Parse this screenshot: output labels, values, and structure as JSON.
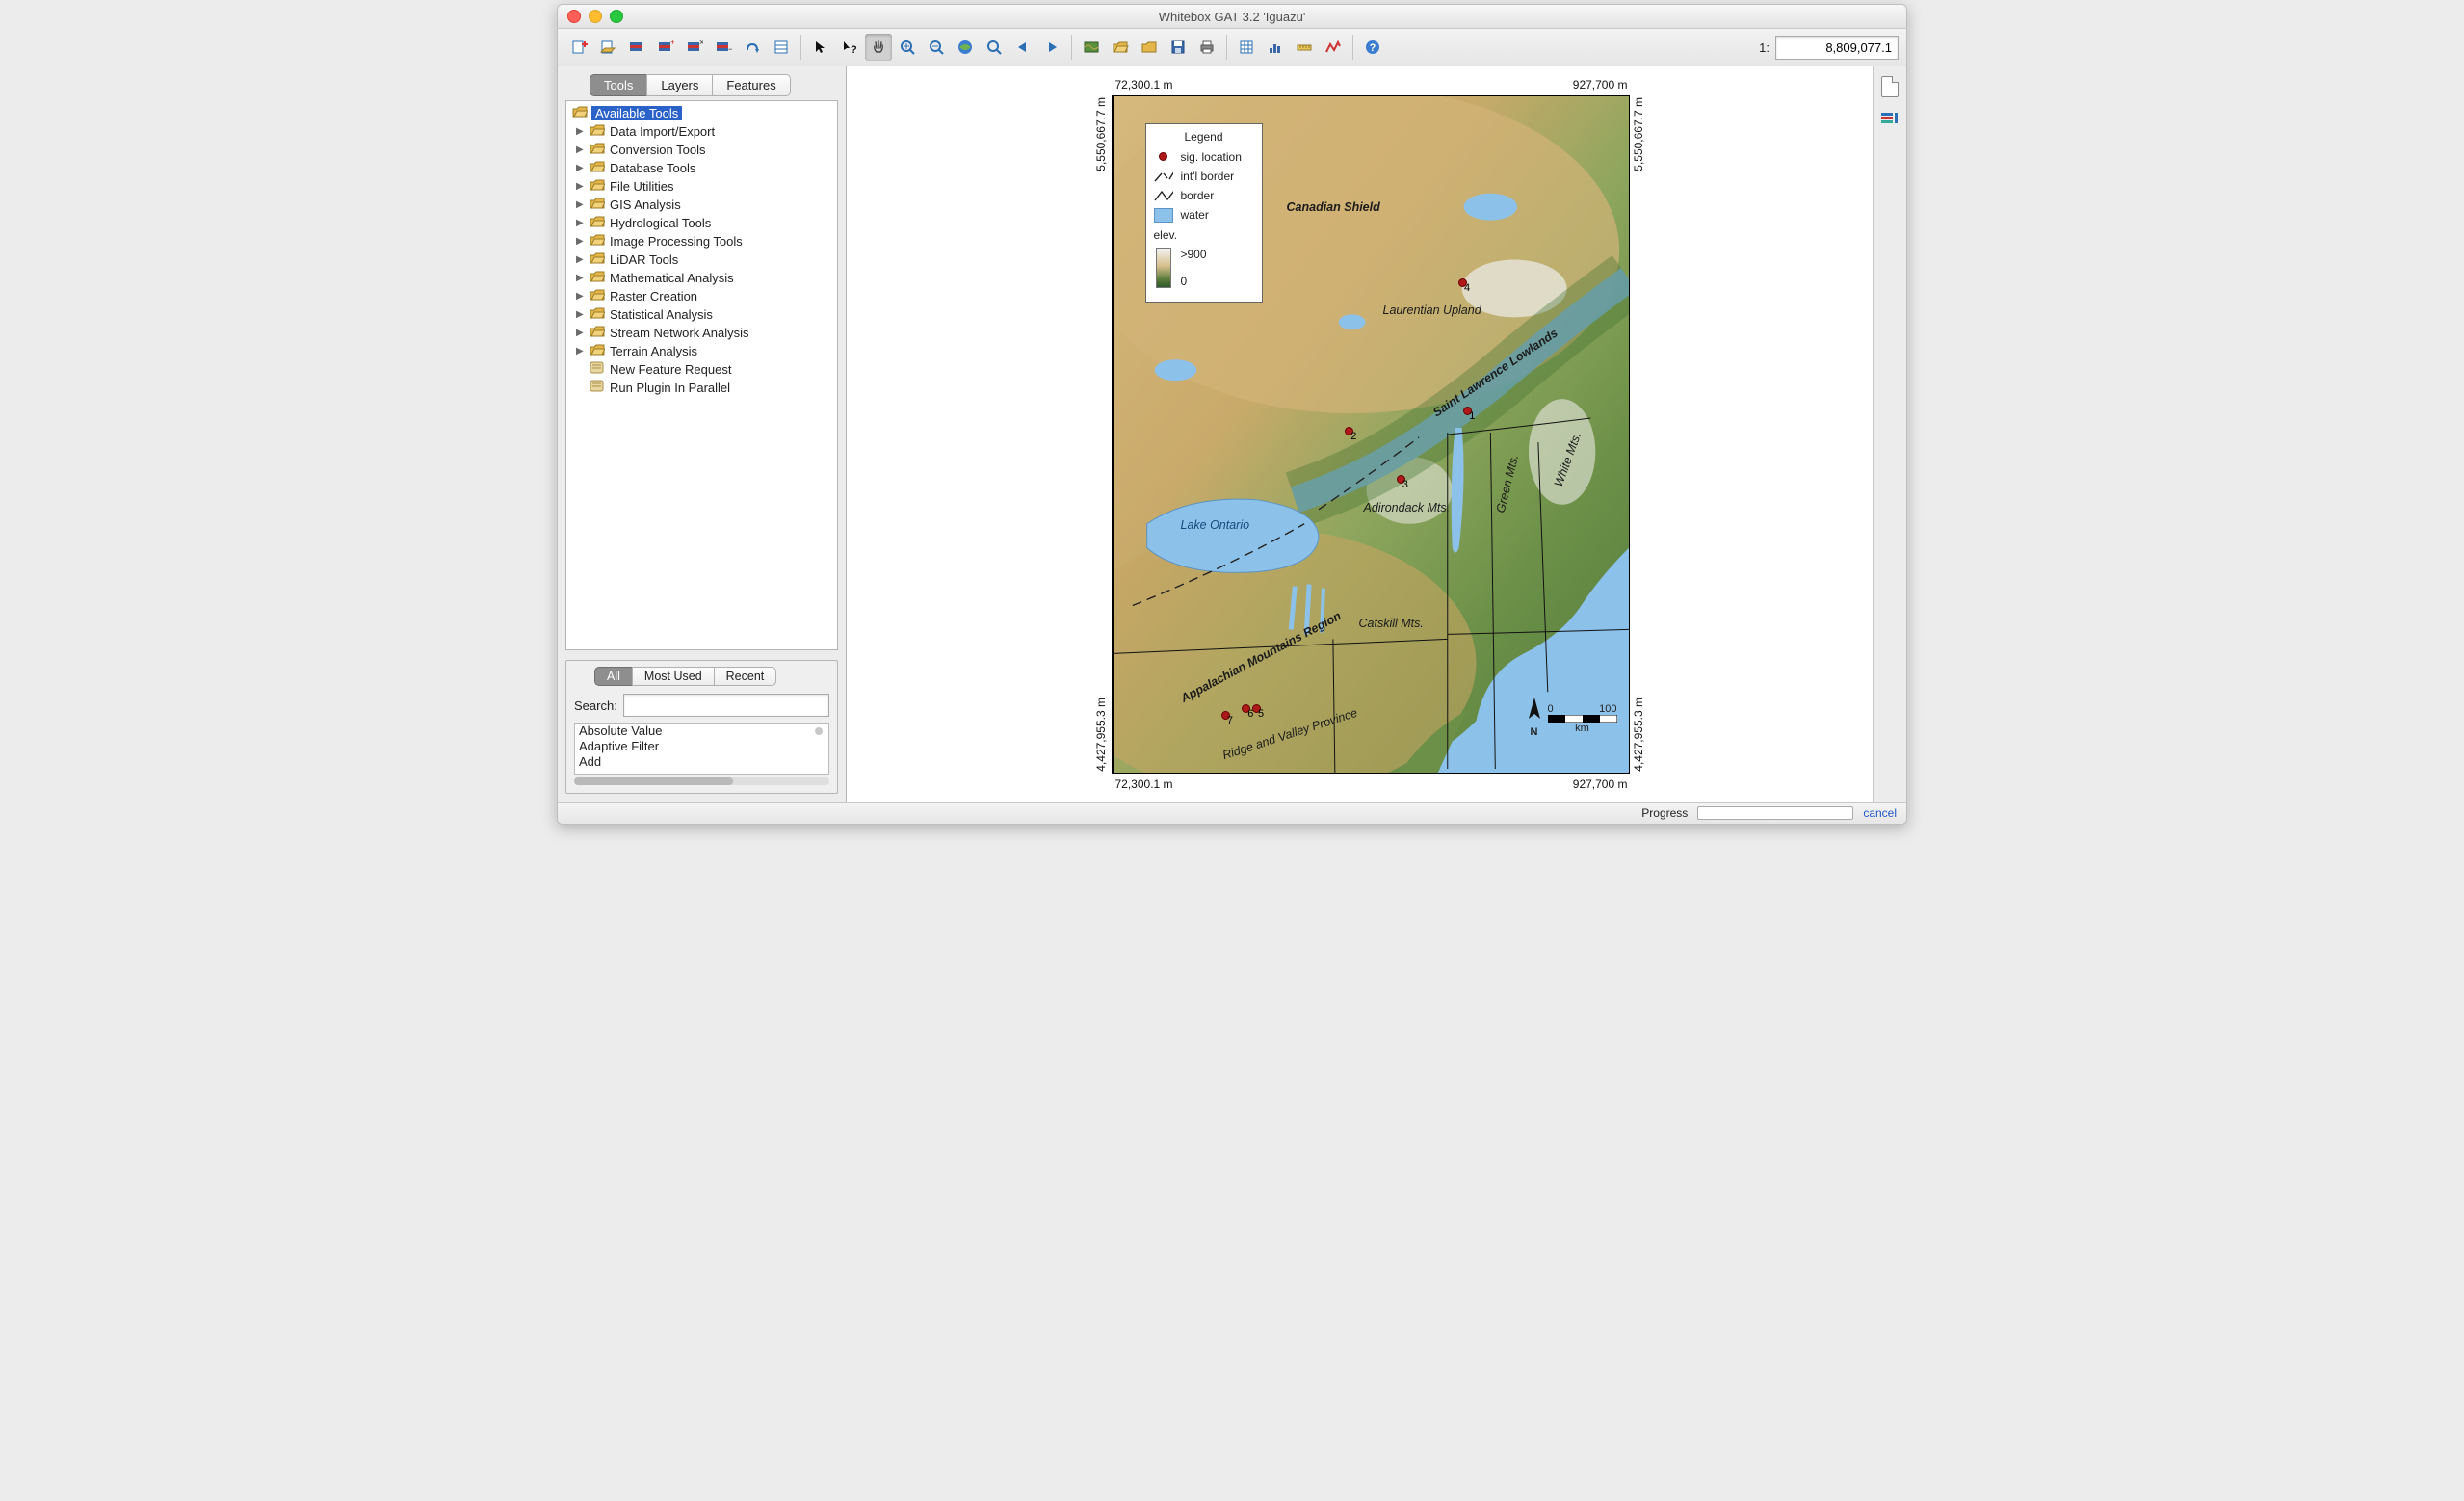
{
  "window": {
    "title": "Whitebox GAT 3.2 'Iguazu'"
  },
  "scale": {
    "prefix": "1:",
    "value": "8,809,077.1"
  },
  "panelTabs": {
    "tools": "Tools",
    "layers": "Layers",
    "features": "Features",
    "active": "tools"
  },
  "tree": {
    "root": "Available Tools",
    "folders": [
      "Data Import/Export",
      "Conversion Tools",
      "Database Tools",
      "File Utilities",
      "GIS Analysis",
      "Hydrological Tools",
      "Image Processing Tools",
      "LiDAR Tools",
      "Mathematical Analysis",
      "Raster Creation",
      "Statistical Analysis",
      "Stream Network Analysis",
      "Terrain Analysis"
    ],
    "leaves": [
      "New Feature Request",
      "Run Plugin In Parallel"
    ]
  },
  "filterTabs": {
    "all": "All",
    "mostUsed": "Most Used",
    "recent": "Recent",
    "active": "all"
  },
  "search": {
    "label": "Search:",
    "value": ""
  },
  "results": [
    "Absolute Value",
    "Adaptive Filter",
    "Add"
  ],
  "map": {
    "axes": {
      "x_left": "72,300.1 m",
      "x_right": "927,700 m",
      "y_top": "5,550,667.7 m",
      "y_bottom": "4,427,955.3 m"
    },
    "legend": {
      "title": "Legend",
      "sig": "sig. location",
      "intl": "int'l border",
      "border": "border",
      "water": "water",
      "elev": "elev.",
      "elev_hi": ">900",
      "elev_lo": "0"
    },
    "labels": {
      "canadian_shield": "Canadian Shield",
      "laurentian": "Laurentian Upland",
      "stlaw": "Saint Lawrence Lowlands",
      "lake_ontario": "Lake Ontario",
      "adirondack": "Adirondack Mts.",
      "green": "Green Mts.",
      "white": "White Mts.",
      "catskill": "Catskill Mts.",
      "appalachian": "Appalachian Mountains Region",
      "ridge": "Ridge and Valley Province"
    },
    "points": [
      {
        "n": "1",
        "x": 68,
        "y": 46
      },
      {
        "n": "2",
        "x": 45,
        "y": 49
      },
      {
        "n": "3",
        "x": 55,
        "y": 56
      },
      {
        "n": "4",
        "x": 67,
        "y": 27
      },
      {
        "n": "5",
        "x": 27,
        "y": 90
      },
      {
        "n": "6",
        "x": 25,
        "y": 90
      },
      {
        "n": "7",
        "x": 21,
        "y": 91
      }
    ],
    "scalebar": {
      "left": "0",
      "right": "100",
      "unit": "km"
    },
    "north": "N"
  },
  "status": {
    "progress": "Progress",
    "cancel": "cancel"
  },
  "toolbar_icons": [
    "new-map",
    "open",
    "print",
    "layer-raster",
    "layer-vector",
    "layer-remove",
    "layer-raise",
    "attribute-table",
    "sep",
    "pointer",
    "pointer-help",
    "pan",
    "zoom-in",
    "zoom-out",
    "zoom-full",
    "zoom-layer",
    "arrow-left",
    "arrow-right",
    "sep",
    "map",
    "folder-open",
    "folder",
    "save",
    "printer",
    "sep",
    "table",
    "histogram",
    "measure",
    "profile",
    "sep",
    "help"
  ]
}
